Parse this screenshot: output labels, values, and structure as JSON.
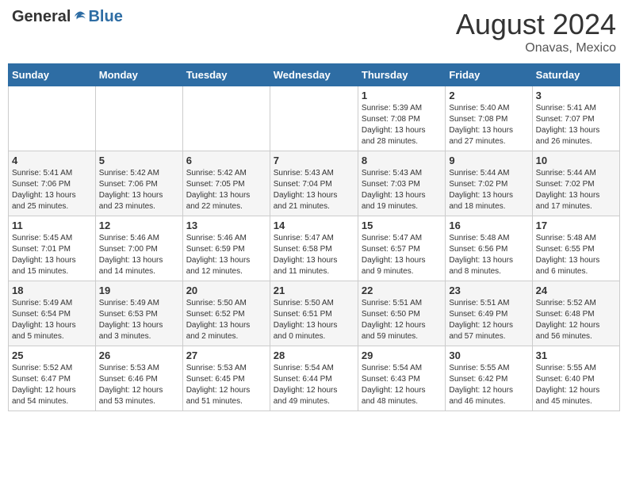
{
  "header": {
    "logo_general": "General",
    "logo_blue": "Blue",
    "month_year": "August 2024",
    "location": "Onavas, Mexico"
  },
  "weekdays": [
    "Sunday",
    "Monday",
    "Tuesday",
    "Wednesday",
    "Thursday",
    "Friday",
    "Saturday"
  ],
  "weeks": [
    [
      {
        "day": "",
        "info": ""
      },
      {
        "day": "",
        "info": ""
      },
      {
        "day": "",
        "info": ""
      },
      {
        "day": "",
        "info": ""
      },
      {
        "day": "1",
        "info": "Sunrise: 5:39 AM\nSunset: 7:08 PM\nDaylight: 13 hours\nand 28 minutes."
      },
      {
        "day": "2",
        "info": "Sunrise: 5:40 AM\nSunset: 7:08 PM\nDaylight: 13 hours\nand 27 minutes."
      },
      {
        "day": "3",
        "info": "Sunrise: 5:41 AM\nSunset: 7:07 PM\nDaylight: 13 hours\nand 26 minutes."
      }
    ],
    [
      {
        "day": "4",
        "info": "Sunrise: 5:41 AM\nSunset: 7:06 PM\nDaylight: 13 hours\nand 25 minutes."
      },
      {
        "day": "5",
        "info": "Sunrise: 5:42 AM\nSunset: 7:06 PM\nDaylight: 13 hours\nand 23 minutes."
      },
      {
        "day": "6",
        "info": "Sunrise: 5:42 AM\nSunset: 7:05 PM\nDaylight: 13 hours\nand 22 minutes."
      },
      {
        "day": "7",
        "info": "Sunrise: 5:43 AM\nSunset: 7:04 PM\nDaylight: 13 hours\nand 21 minutes."
      },
      {
        "day": "8",
        "info": "Sunrise: 5:43 AM\nSunset: 7:03 PM\nDaylight: 13 hours\nand 19 minutes."
      },
      {
        "day": "9",
        "info": "Sunrise: 5:44 AM\nSunset: 7:02 PM\nDaylight: 13 hours\nand 18 minutes."
      },
      {
        "day": "10",
        "info": "Sunrise: 5:44 AM\nSunset: 7:02 PM\nDaylight: 13 hours\nand 17 minutes."
      }
    ],
    [
      {
        "day": "11",
        "info": "Sunrise: 5:45 AM\nSunset: 7:01 PM\nDaylight: 13 hours\nand 15 minutes."
      },
      {
        "day": "12",
        "info": "Sunrise: 5:46 AM\nSunset: 7:00 PM\nDaylight: 13 hours\nand 14 minutes."
      },
      {
        "day": "13",
        "info": "Sunrise: 5:46 AM\nSunset: 6:59 PM\nDaylight: 13 hours\nand 12 minutes."
      },
      {
        "day": "14",
        "info": "Sunrise: 5:47 AM\nSunset: 6:58 PM\nDaylight: 13 hours\nand 11 minutes."
      },
      {
        "day": "15",
        "info": "Sunrise: 5:47 AM\nSunset: 6:57 PM\nDaylight: 13 hours\nand 9 minutes."
      },
      {
        "day": "16",
        "info": "Sunrise: 5:48 AM\nSunset: 6:56 PM\nDaylight: 13 hours\nand 8 minutes."
      },
      {
        "day": "17",
        "info": "Sunrise: 5:48 AM\nSunset: 6:55 PM\nDaylight: 13 hours\nand 6 minutes."
      }
    ],
    [
      {
        "day": "18",
        "info": "Sunrise: 5:49 AM\nSunset: 6:54 PM\nDaylight: 13 hours\nand 5 minutes."
      },
      {
        "day": "19",
        "info": "Sunrise: 5:49 AM\nSunset: 6:53 PM\nDaylight: 13 hours\nand 3 minutes."
      },
      {
        "day": "20",
        "info": "Sunrise: 5:50 AM\nSunset: 6:52 PM\nDaylight: 13 hours\nand 2 minutes."
      },
      {
        "day": "21",
        "info": "Sunrise: 5:50 AM\nSunset: 6:51 PM\nDaylight: 13 hours\nand 0 minutes."
      },
      {
        "day": "22",
        "info": "Sunrise: 5:51 AM\nSunset: 6:50 PM\nDaylight: 12 hours\nand 59 minutes."
      },
      {
        "day": "23",
        "info": "Sunrise: 5:51 AM\nSunset: 6:49 PM\nDaylight: 12 hours\nand 57 minutes."
      },
      {
        "day": "24",
        "info": "Sunrise: 5:52 AM\nSunset: 6:48 PM\nDaylight: 12 hours\nand 56 minutes."
      }
    ],
    [
      {
        "day": "25",
        "info": "Sunrise: 5:52 AM\nSunset: 6:47 PM\nDaylight: 12 hours\nand 54 minutes."
      },
      {
        "day": "26",
        "info": "Sunrise: 5:53 AM\nSunset: 6:46 PM\nDaylight: 12 hours\nand 53 minutes."
      },
      {
        "day": "27",
        "info": "Sunrise: 5:53 AM\nSunset: 6:45 PM\nDaylight: 12 hours\nand 51 minutes."
      },
      {
        "day": "28",
        "info": "Sunrise: 5:54 AM\nSunset: 6:44 PM\nDaylight: 12 hours\nand 49 minutes."
      },
      {
        "day": "29",
        "info": "Sunrise: 5:54 AM\nSunset: 6:43 PM\nDaylight: 12 hours\nand 48 minutes."
      },
      {
        "day": "30",
        "info": "Sunrise: 5:55 AM\nSunset: 6:42 PM\nDaylight: 12 hours\nand 46 minutes."
      },
      {
        "day": "31",
        "info": "Sunrise: 5:55 AM\nSunset: 6:40 PM\nDaylight: 12 hours\nand 45 minutes."
      }
    ]
  ]
}
